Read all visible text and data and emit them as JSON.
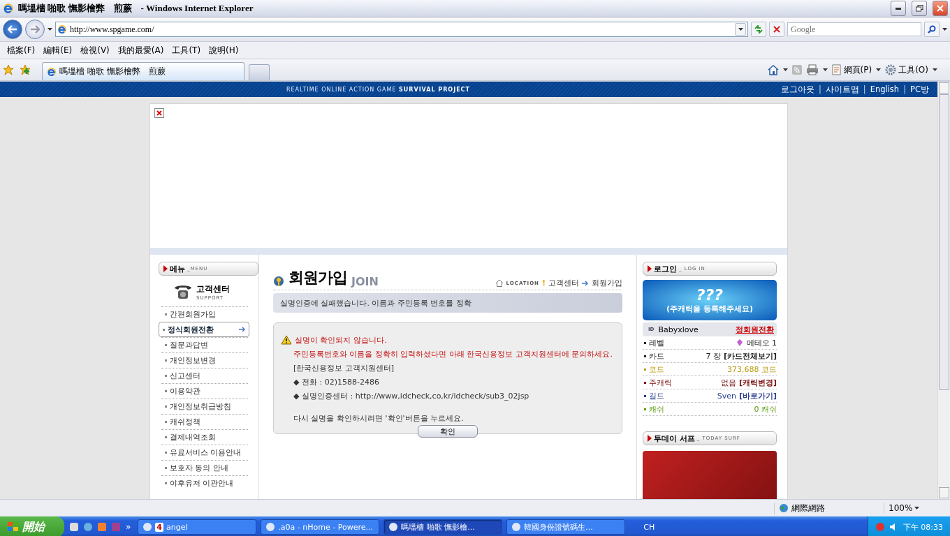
{
  "window": {
    "title": "嗎塭檣 啪歌 憮影檜弊　煎蕨　- Windows Internet Explorer"
  },
  "address_bar": {
    "url": "http://www.spgame.com/"
  },
  "search": {
    "placeholder": "Google"
  },
  "menu_bar": [
    "檔案(F)",
    "編輯(E)",
    "檢視(V)",
    "我的最愛(A)",
    "工具(T)",
    "說明(H)"
  ],
  "tab": {
    "title": "嗎塭檣 啪歌 憮影檜弊　煎蕨"
  },
  "command_bar": {
    "page": "網頁(P)",
    "tools": "工具(O)"
  },
  "page": {
    "header": {
      "tagline_light": "REALTIME ONLINE ACTION GAME",
      "tagline_bold": "SURVIVAL PROJECT",
      "links": [
        "로그아웃",
        "사이트맵",
        "English",
        "PC방"
      ],
      "separator": "|"
    },
    "left_menu": {
      "title": "메뉴",
      "title_sub": "_MENU",
      "section": "고객센터",
      "section_sub": "SUPPORT",
      "items": [
        {
          "label": "간편회원가입",
          "selected": false
        },
        {
          "label": "정식회원전환",
          "selected": true
        },
        {
          "label": "질문과답변",
          "selected": false
        },
        {
          "label": "개인정보변경",
          "selected": false
        },
        {
          "label": "신고센터",
          "selected": false
        },
        {
          "label": "이용약관",
          "selected": false
        },
        {
          "label": "개인정보취급방침",
          "selected": false
        },
        {
          "label": "캐쉬정책",
          "selected": false
        },
        {
          "label": "결제내역조회",
          "selected": false
        },
        {
          "label": "유료서비스 이용안내",
          "selected": false
        },
        {
          "label": "보호자 동의 안내",
          "selected": false
        },
        {
          "label": "야후유저 이관안내",
          "selected": false
        }
      ]
    },
    "content": {
      "title": "회원가입",
      "title_sub": "JOIN",
      "location_label": "LOCATION",
      "location_mark": "!",
      "breadcrumb": [
        "고객센터",
        "회원가입"
      ],
      "notice": "실명인증에 실패했습니다. 이름과 주민등록 번호를 정확",
      "message": [
        {
          "kind": "warning",
          "text": "실명이 확인되지 않습니다."
        },
        {
          "kind": "error",
          "text": "주민등록번호와 이름을 정확히 입력하셨다면 아래 한국신용정보 고객지원센터에 문의하세요."
        },
        {
          "kind": "plain",
          "text": "[한국신용정보 고객지원센터]"
        },
        {
          "kind": "bullet",
          "text": "◆ 전화 : 02)1588-2486"
        },
        {
          "kind": "bullet",
          "text": "◆ 실명인증센터 : http://www,idcheck,co,kr/idcheck/sub3_02jsp"
        },
        {
          "kind": "spacer"
        },
        {
          "kind": "plain",
          "text": "다시 실명을 확인하시려면 '확인'버튼을 누르세요."
        }
      ],
      "button": "확인"
    },
    "login": {
      "title": "로그인",
      "title_sub": "_ LOG IN",
      "banner_mark": "???",
      "banner_text": "(주캐릭을 등록해주세요)",
      "id_label": "ID",
      "user": "Babyxlove",
      "upgrade_link": "정회원전환",
      "stats": [
        {
          "label": "레벨",
          "value": "메테오 1",
          "color": "#222222",
          "icon": true
        },
        {
          "label": "카드",
          "value": "7 장",
          "link": "[카드전체보기]",
          "color": "#222222",
          "icon": false
        },
        {
          "label": "코드",
          "value": "373,688 코드",
          "color": "#b89a10",
          "icon": false
        },
        {
          "label": "주캐릭",
          "value": "없음",
          "link": "[캐릭변경]",
          "color": "#7a1010",
          "icon": false
        },
        {
          "label": "길드",
          "value": "Sven",
          "link": "[바로가기]",
          "color": "#2a3f8f",
          "icon": false
        },
        {
          "label": "캐쉬",
          "value": "0 캐쉬",
          "color": "#5a9a10",
          "icon": false
        }
      ]
    },
    "today_surf": {
      "title": "투데이 서프",
      "title_sub": "_ TODAY SURF"
    }
  },
  "status_bar": {
    "zone": "網際網路",
    "zoom": "100%"
  },
  "taskbar": {
    "start": "開始",
    "more": "»",
    "buttons": [
      {
        "badge": "4",
        "label": "angel",
        "selected": false
      },
      {
        "label": ".a0a - nHome - Powere...",
        "selected": false
      },
      {
        "label": "嗎塭檣 啪歌 憮影檜...",
        "selected": true
      },
      {
        "label": "韓國身份證號碼生...",
        "selected": false
      }
    ],
    "language": "CH",
    "clock": "下午 08:33"
  }
}
